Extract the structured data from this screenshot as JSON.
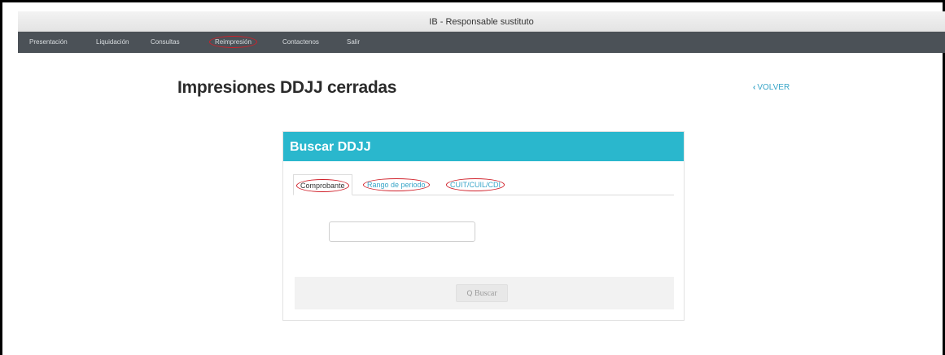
{
  "window": {
    "title": "IB - Responsable sustituto"
  },
  "nav": {
    "items": [
      {
        "label": "Presentación"
      },
      {
        "label": "Liquidación"
      },
      {
        "label": "Consultas"
      },
      {
        "label": "Reimpresión"
      },
      {
        "label": "Contactenos"
      },
      {
        "label": "Salir"
      }
    ]
  },
  "page": {
    "title": "Impresiones DDJJ cerradas",
    "back_label": "VOLVER",
    "back_icon": "chevron-left-icon"
  },
  "card": {
    "title": "Buscar DDJJ",
    "tabs": [
      {
        "label": "Comprobante"
      },
      {
        "label": "Rango de periodo"
      },
      {
        "label": "CUIT/CUIL/CDI"
      }
    ],
    "input": {
      "value": "",
      "placeholder": ""
    },
    "search_label": "Buscar",
    "search_icon": "search-icon"
  },
  "colors": {
    "nav_bg": "#4b5157",
    "header_bg": "#2ab7cd",
    "link": "#37a5c8",
    "highlight_ring": "#d0202a"
  }
}
